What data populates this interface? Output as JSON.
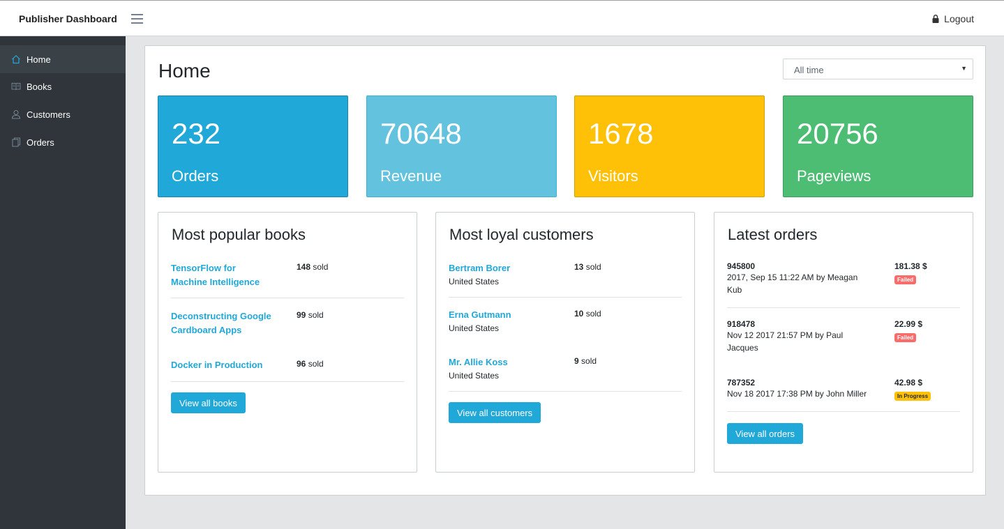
{
  "header": {
    "brand": "Publisher Dashboard",
    "logout_label": "Logout"
  },
  "sidebar": {
    "items": [
      {
        "label": "Home",
        "icon": "home-icon",
        "active": true
      },
      {
        "label": "Books",
        "icon": "book-icon",
        "active": false
      },
      {
        "label": "Customers",
        "icon": "user-icon",
        "active": false
      },
      {
        "label": "Orders",
        "icon": "document-icon",
        "active": false
      }
    ]
  },
  "main": {
    "title": "Home",
    "period_select": {
      "value": "All time"
    },
    "stats": [
      {
        "value": "232",
        "label": "Orders",
        "color": "#20a8d8"
      },
      {
        "value": "70648",
        "label": "Revenue",
        "color": "#63c2de"
      },
      {
        "value": "1678",
        "label": "Visitors",
        "color": "#ffc107"
      },
      {
        "value": "20756",
        "label": "Pageviews",
        "color": "#4dbd74"
      }
    ],
    "popular_books": {
      "title": "Most popular books",
      "items": [
        {
          "line1": "TensorFlow for",
          "line2": "Machine Intelligence",
          "count": "148",
          "suffix": "sold"
        },
        {
          "line1": "Deconstructing Google",
          "line2": "Cardboard Apps",
          "count": "99",
          "suffix": "sold"
        },
        {
          "line1": "Docker in Production",
          "count": "96",
          "suffix": "sold"
        }
      ],
      "button": "View all books"
    },
    "loyal_customers": {
      "title": "Most loyal customers",
      "items": [
        {
          "name": "Bertram Borer",
          "country": "United States",
          "count": "13",
          "suffix": "sold"
        },
        {
          "name": "Erna Gutmann",
          "country": "United States",
          "count": "10",
          "suffix": "sold"
        },
        {
          "name": "Mr. Allie Koss",
          "country": "United States",
          "count": "9",
          "suffix": "sold"
        }
      ],
      "button": "View all customers"
    },
    "latest_orders": {
      "title": "Latest orders",
      "items": [
        {
          "id": "945800",
          "line1": "2017, Sep 15 11:22 AM by  Meagan",
          "line2": "Kub",
          "price": "181.38 $",
          "status": "Failed"
        },
        {
          "id": "918478",
          "line1": "Nov 12 2017 21:57 PM by  Paul",
          "line2": "Jacques",
          "price": "22.99 $",
          "status": "Failed"
        },
        {
          "id": "787352",
          "line1": "Nov 18 2017 17:38 PM by  John Miller",
          "price": "42.98 $",
          "status": "In Progress"
        }
      ],
      "button": "View all orders"
    }
  }
}
